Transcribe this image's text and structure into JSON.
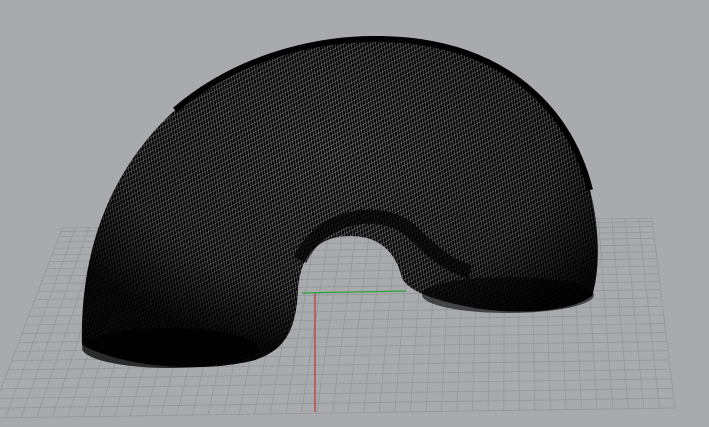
{
  "viewport": {
    "background_color": "#a8aaad",
    "display_mode": "wireframe",
    "grid": {
      "visible": true,
      "line_color": "#94979a"
    },
    "axes": {
      "x_axis_color": "#c0392b",
      "y_axis_color": "#27a33a"
    },
    "object": {
      "shape": "half-torus",
      "mesh_color": "#050505",
      "wire_color": "#c4c4c4"
    }
  }
}
